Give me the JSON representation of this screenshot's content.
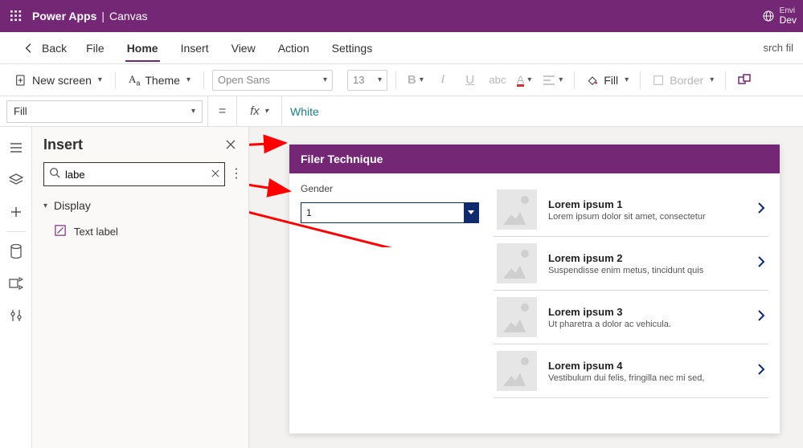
{
  "brand": {
    "app": "Power Apps",
    "section": "Canvas",
    "env_label": "Envi",
    "env_value": "Dev"
  },
  "menu": {
    "back": "Back",
    "items": [
      "File",
      "Home",
      "Insert",
      "View",
      "Action",
      "Settings"
    ],
    "active_index": 1,
    "search_placeholder": "srch fil"
  },
  "ribbon": {
    "new_screen": "New screen",
    "theme": "Theme",
    "font_name": "Open Sans",
    "font_size": "13",
    "fill": "Fill",
    "border": "Border"
  },
  "formula": {
    "property": "Fill",
    "fx": "fx",
    "value": "White"
  },
  "pane": {
    "title": "Insert",
    "search_value": "labe",
    "group": "Display",
    "item": "Text label"
  },
  "app": {
    "title": "Filer Technique",
    "gender_label": "Gender",
    "dropdown_value": "1",
    "list": [
      {
        "title": "Lorem ipsum 1",
        "sub": "Lorem ipsum dolor sit amet, consectetur"
      },
      {
        "title": "Lorem ipsum 2",
        "sub": "Suspendisse enim metus, tincidunt quis"
      },
      {
        "title": "Lorem ipsum 3",
        "sub": "Ut pharetra a dolor ac vehicula."
      },
      {
        "title": "Lorem ipsum 4",
        "sub": "Vestibulum dui felis, fringilla nec mi sed,"
      }
    ]
  }
}
